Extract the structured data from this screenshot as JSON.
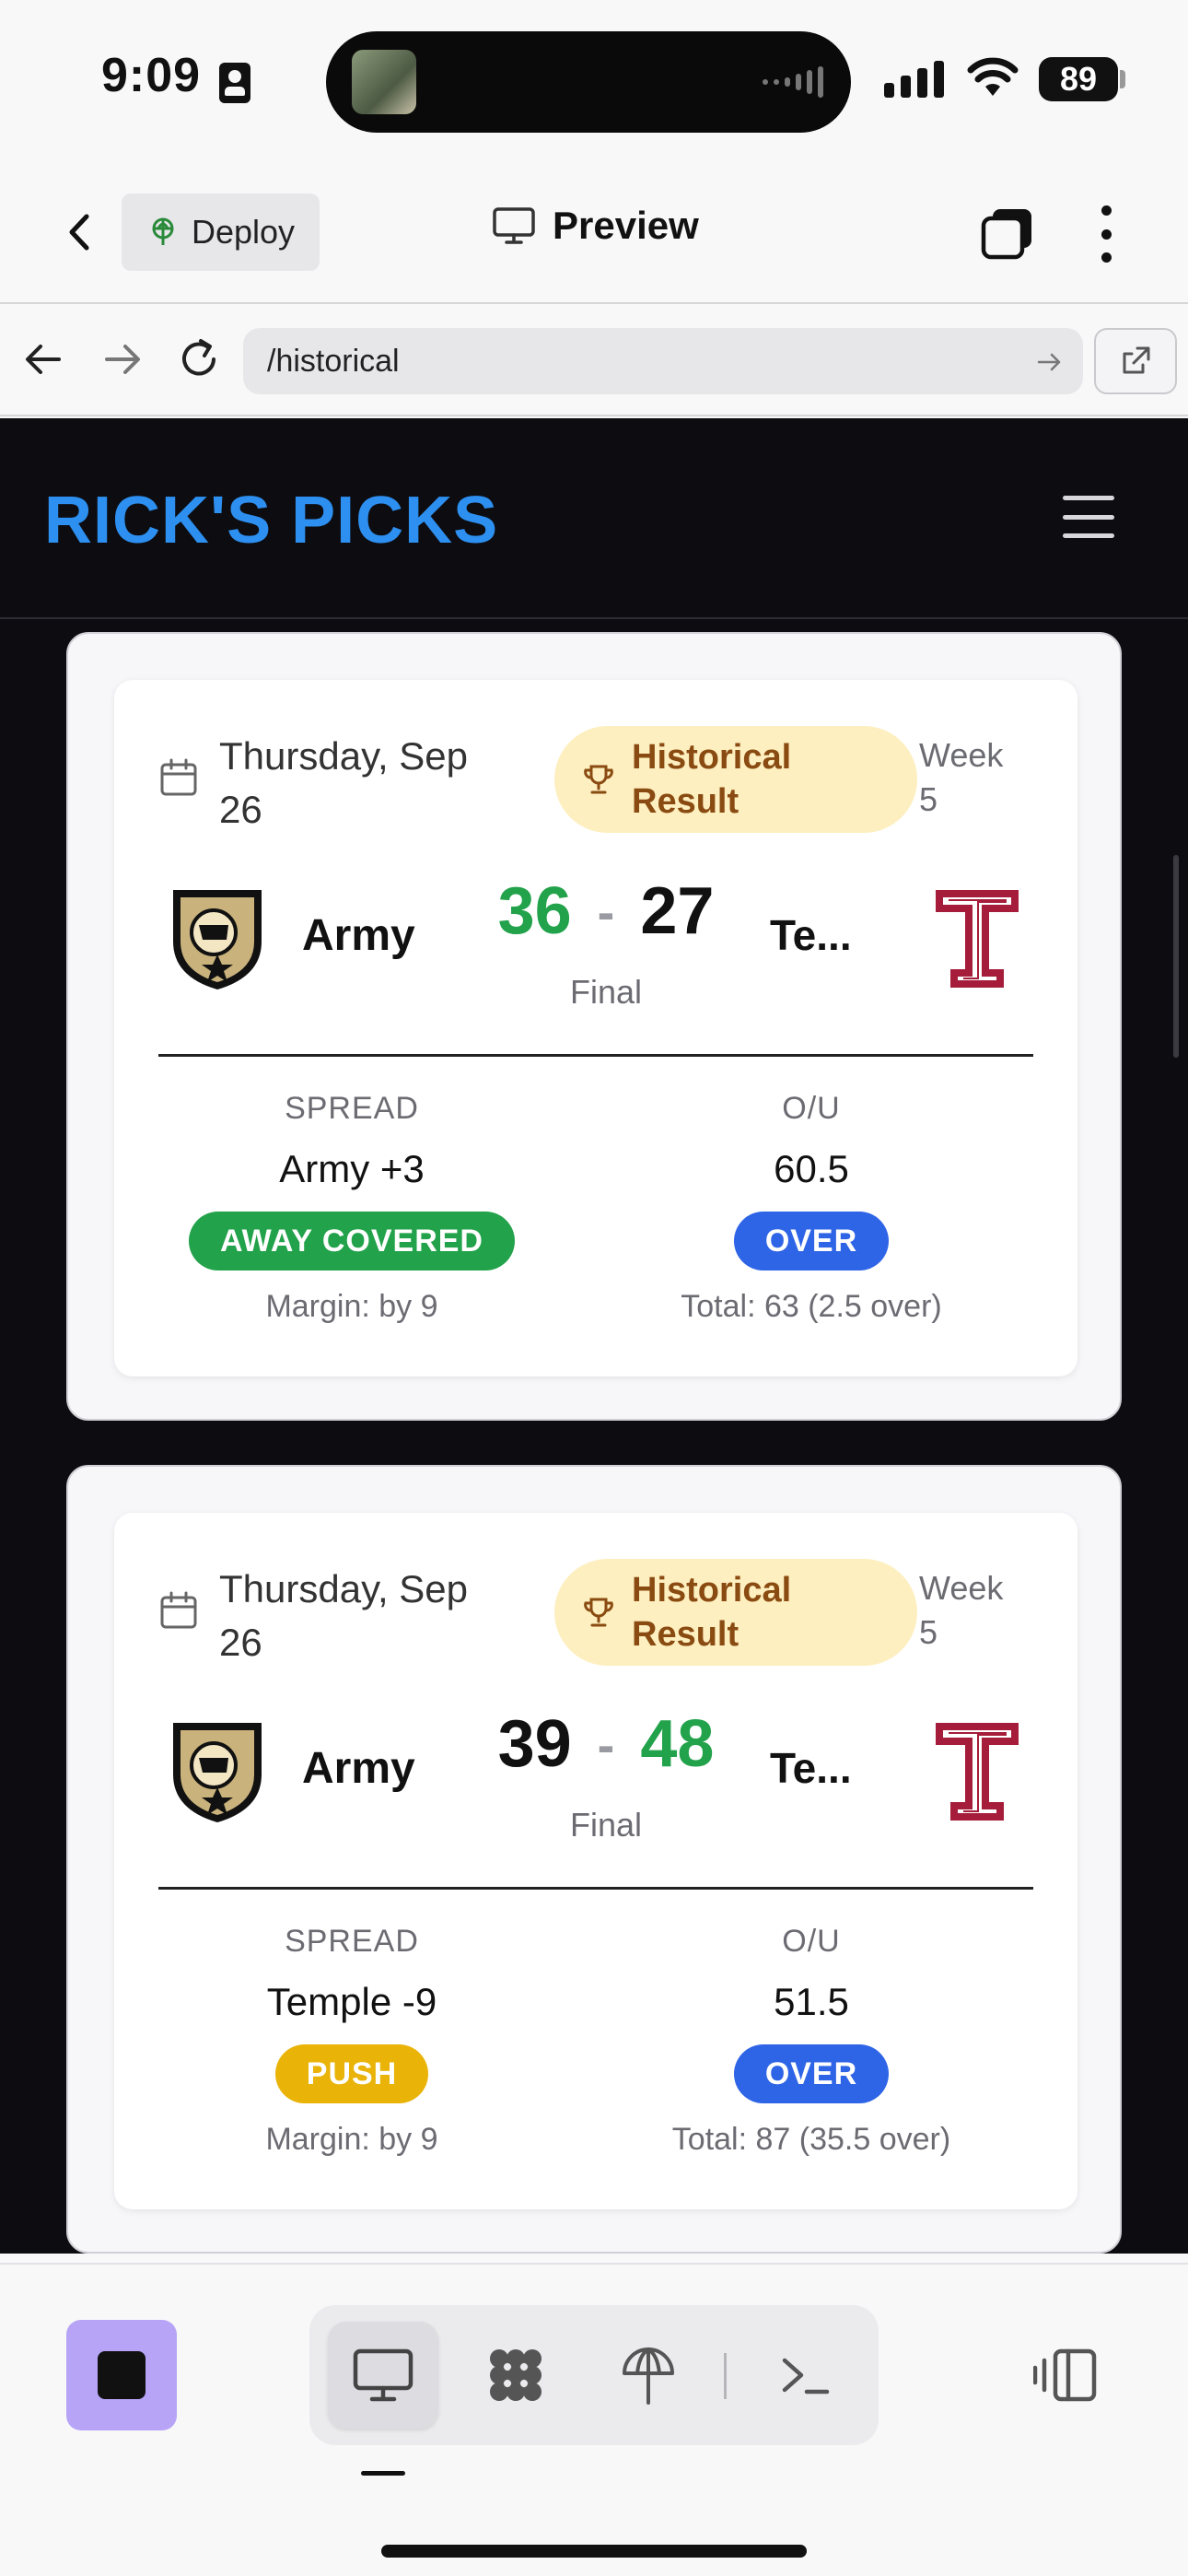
{
  "status": {
    "time": "9:09",
    "battery": "89"
  },
  "app_bar": {
    "deploy_label": "Deploy",
    "preview_label": "Preview"
  },
  "url_bar": {
    "url": "/historical"
  },
  "site": {
    "logo": "RICK'S PICKS",
    "accent": "#2d8ff0"
  },
  "games": [
    {
      "date": "Thursday, Sep 26",
      "badge": "Historical Result",
      "week": "Week 5",
      "away_team": "Army",
      "home_team": "Te...",
      "away_score": "36",
      "score_sep": "-",
      "home_score": "27",
      "status": "Final",
      "winner": "away",
      "spread_header": "SPREAD",
      "spread_value": "Army +3",
      "spread_result": "AWAY COVERED",
      "spread_result_color": "#22a24a",
      "spread_margin": "Margin: by 9",
      "ou_header": "O/U",
      "ou_value": "60.5",
      "ou_result": "OVER",
      "ou_result_color": "#2e64e6",
      "ou_total": "Total: 63 (2.5 over)"
    },
    {
      "date": "Thursday, Sep 26",
      "badge": "Historical Result",
      "week": "Week 5",
      "away_team": "Army",
      "home_team": "Te...",
      "away_score": "39",
      "score_sep": "-",
      "home_score": "48",
      "status": "Final",
      "winner": "home",
      "spread_header": "SPREAD",
      "spread_value": "Temple -9",
      "spread_result": "PUSH",
      "spread_result_color": "#e9b308",
      "spread_margin": "Margin: by 9",
      "ou_header": "O/U",
      "ou_value": "51.5",
      "ou_result": "OVER",
      "ou_result_color": "#2e64e6",
      "ou_total": "Total: 87 (35.5 over)"
    }
  ],
  "icons": {
    "back": "chevron-left-icon",
    "deploy": "deploy-globe-icon",
    "preview": "monitor-icon",
    "tabs": "tabs-icon",
    "more": "more-vertical-icon",
    "calendar": "calendar-icon",
    "trophy": "trophy-icon",
    "menu": "hamburger-icon"
  }
}
